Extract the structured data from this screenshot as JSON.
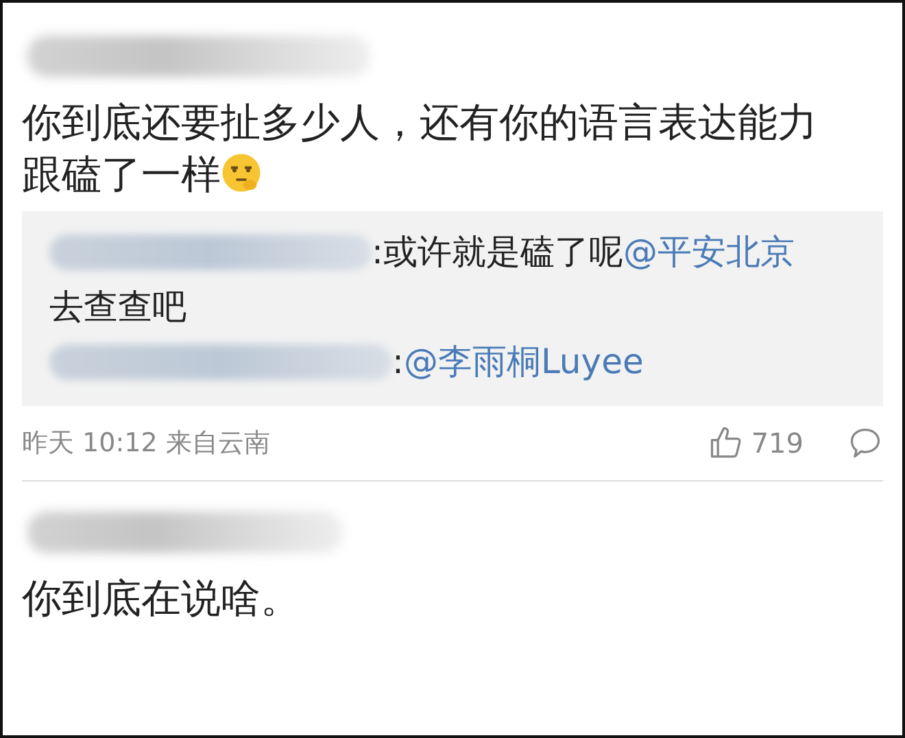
{
  "comments": [
    {
      "text": "你到底还要扯多少人，还有你的语言表达能力跟磕了一样",
      "emoji": true,
      "replies": [
        {
          "text": ":或许就是磕了呢",
          "mention": "@平安北京",
          "after": "去查查吧"
        },
        {
          "text": ":",
          "mention": "@李雨桐Luyee"
        }
      ],
      "time": "昨天 10:12 来自云南",
      "likes": "719"
    },
    {
      "text": "你到底在说啥。",
      "emoji": false
    }
  ]
}
